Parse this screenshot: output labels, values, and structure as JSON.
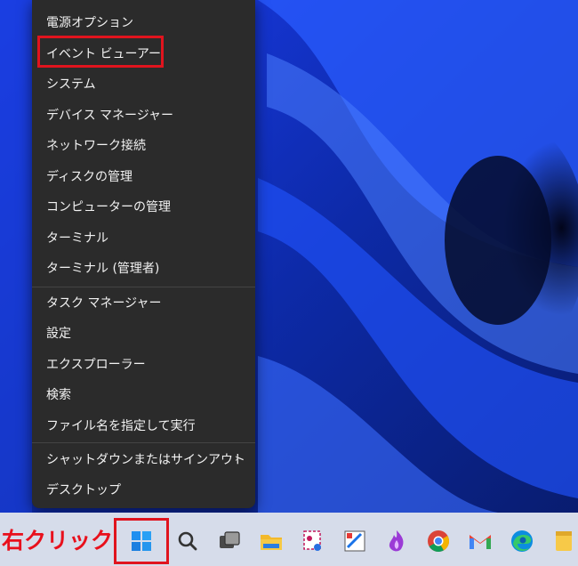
{
  "context_menu": {
    "groups": [
      [
        "電源オプション",
        "イベント ビューアー",
        "システム",
        "デバイス マネージャー",
        "ネットワーク接続",
        "ディスクの管理",
        "コンピューターの管理",
        "ターミナル",
        "ターミナル (管理者)"
      ],
      [
        "タスク マネージャー",
        "設定",
        "エクスプローラー",
        "検索",
        "ファイル名を指定して実行"
      ],
      [
        "シャットダウンまたはサインアウト",
        "デスクトップ"
      ]
    ],
    "submenu_arrow": "›",
    "highlighted_item": "イベント ビューアー"
  },
  "annotation": {
    "label": "右クリック",
    "color": "#e0141e"
  },
  "taskbar": {
    "icons": [
      "windows-start-icon",
      "search-icon",
      "task-view-icon",
      "file-explorer-icon",
      "snipping-tool-icon",
      "paint-icon",
      "app-icon",
      "chrome-icon",
      "gmail-icon",
      "edge-icon",
      "sticky-notes-icon"
    ]
  },
  "colors": {
    "menu_background": "#2b2b2b",
    "menu_text": "#f2f2f2",
    "taskbar": "#d6dcea",
    "wallpaper_blue": "#1e4bff"
  }
}
